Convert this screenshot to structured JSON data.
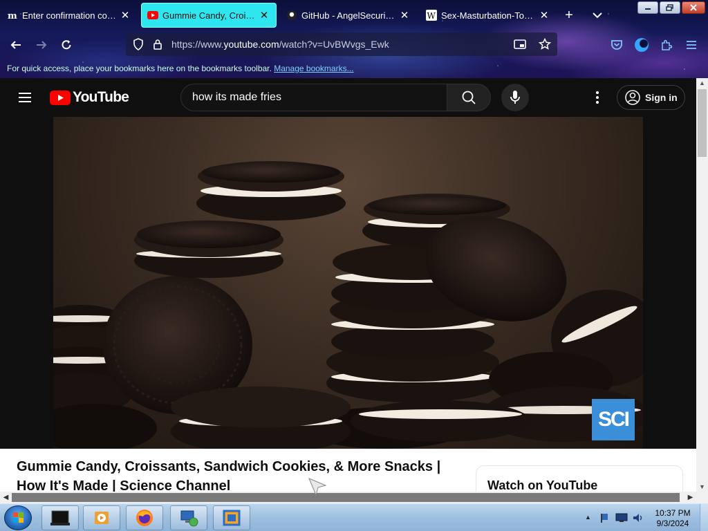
{
  "browser": {
    "tabs": [
      {
        "title": "Enter confirmation code | M",
        "favicon": "medium-m-icon",
        "active": false
      },
      {
        "title": "Gummie Candy, Croissants",
        "favicon": "youtube-icon",
        "active": true
      },
      {
        "title": "GitHub - AngelSecurityTea",
        "favicon": "github-icon",
        "active": false
      },
      {
        "title": "Sex-Masturbation-Toys Co",
        "favicon": "wikipedia-w-icon",
        "active": false
      }
    ],
    "new_tab_label": "+",
    "url_prefix": "https://www.",
    "url_domain": "youtube.com",
    "url_path": "/watch?v=UvBWvgs_Ewk",
    "bookmarks_hint": "For quick access, place your bookmarks here on the bookmarks toolbar.",
    "bookmarks_link": "Manage bookmarks..."
  },
  "youtube": {
    "logo_text": "YouTube",
    "search_value": "how its made fries",
    "signin_label": "Sign in",
    "video_title": "Gummie Candy, Croissants, Sandwich Cookies, & More Snacks | How It's Made | Science Channel",
    "watch_on_label": "Watch on YouTube",
    "channel_badge": "SCI"
  },
  "taskbar": {
    "time": "10:37 PM",
    "date": "9/3/2024"
  },
  "colors": {
    "active_tab": "#2ee6f0",
    "youtube_red": "#ff0000",
    "sci_badge": "#3a8fd8"
  }
}
